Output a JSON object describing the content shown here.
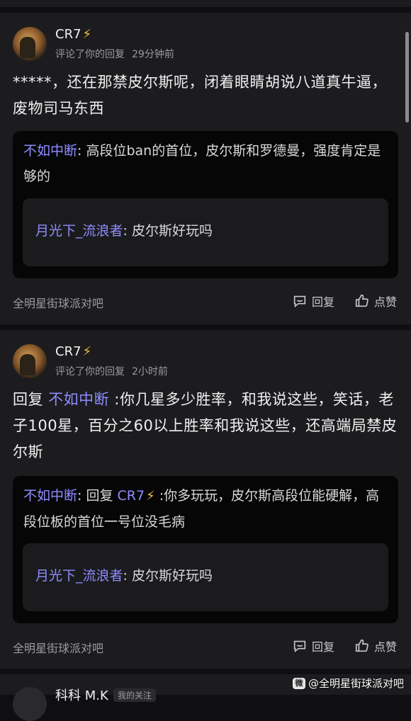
{
  "comments": [
    {
      "username": "CR7",
      "bolt": "⚡",
      "action": "评论了你的回复",
      "time": "29分钟前",
      "content": "*****，还在那禁皮尔斯呢，闭着眼睛胡说八道真牛逼，废物司马东西",
      "quote_author": "不如中断",
      "quote_text": ": 高段位ban的首位，皮尔斯和罗德曼，强度肯定是够的",
      "inner_author": "月光下_流浪者",
      "inner_text": ": 皮尔斯好玩吗",
      "forum": "全明星街球派对吧",
      "reply_label": "回复",
      "like_label": "点赞"
    },
    {
      "username": "CR7",
      "bolt": "⚡",
      "action": "评论了你的回复",
      "time": "2小时前",
      "content_prefix": "回复 ",
      "content_mention": "不如中断",
      "content_rest": " :你几星多少胜率，和我说这些，笑话，老子100星，百分之60以上胜率和我说这些，还高端局禁皮尔斯",
      "quote_author": "不如中断",
      "quote_mid": ": 回复 ",
      "quote_mention": "CR7",
      "quote_bolt": "⚡",
      "quote_rest": " :你多玩玩，皮尔斯高段位能硬解，高段位板的首位一号位没毛病",
      "inner_author": "月光下_流浪者",
      "inner_text": ": 皮尔斯好玩吗",
      "forum": "全明星街球派对吧",
      "reply_label": "回复",
      "like_label": "点赞"
    }
  ],
  "peek": {
    "name": "科科 M.K",
    "tag": "我的关注"
  },
  "watermark": {
    "icon": "微",
    "text": "@全明星街球派对吧"
  }
}
